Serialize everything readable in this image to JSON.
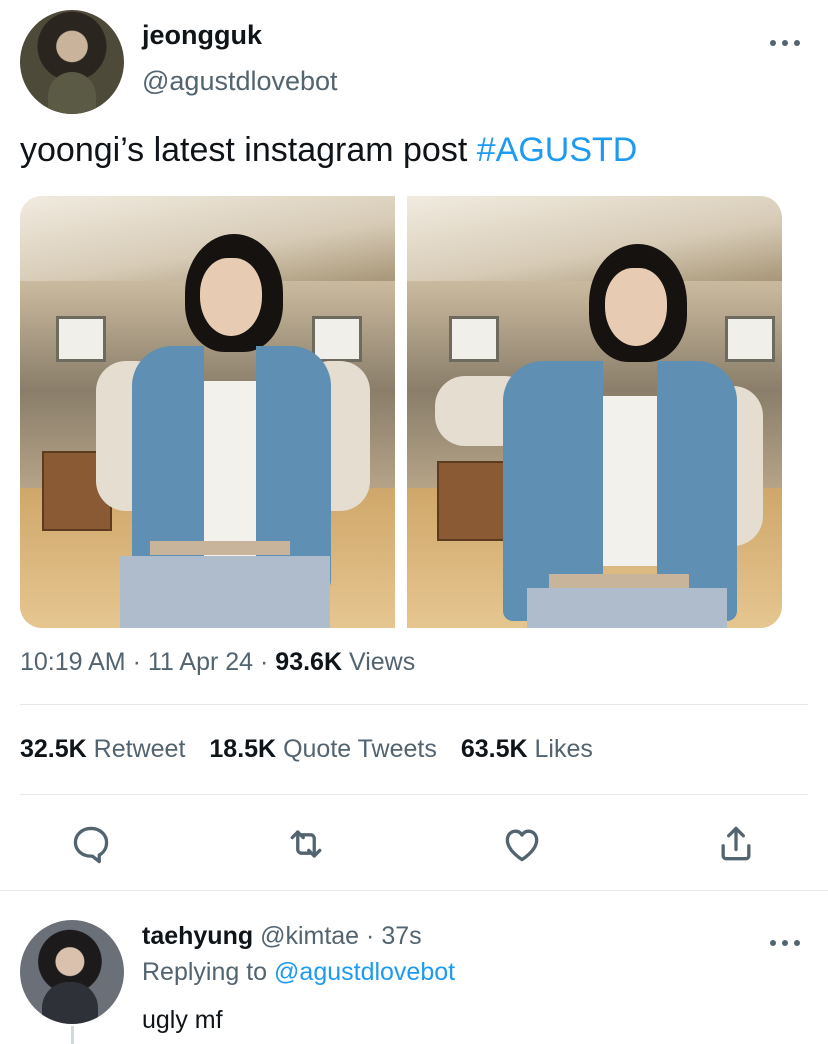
{
  "tweet": {
    "author_name": "jeongguk",
    "author_handle": "@agustdlovebot",
    "text": "yoongi’s latest instagram post ",
    "hashtag": "#AGUSTD",
    "time": "10:19 AM",
    "date": "11 Apr 24",
    "views_count": "93.6K",
    "views_label": "Views",
    "separator": "·"
  },
  "stats": {
    "retweets_count": "32.5K",
    "retweets_label": "Retweet",
    "quotes_count": "18.5K",
    "quotes_label": "Quote Tweets",
    "likes_count": "63.5K",
    "likes_label": "Likes"
  },
  "actions": {
    "icons": [
      "reply-icon",
      "retweet-icon",
      "like-icon",
      "share-icon"
    ]
  },
  "reply": {
    "author_name": "taehyung",
    "author_handle": "@kimtae",
    "time": "37s",
    "replying_to_label": "Replying to",
    "replying_to_handle": "@agustdlovebot",
    "text": "ugly mf"
  },
  "colors": {
    "accent": "#1d9bf0",
    "secondary_text": "#536471",
    "primary_text": "#0f1419"
  }
}
